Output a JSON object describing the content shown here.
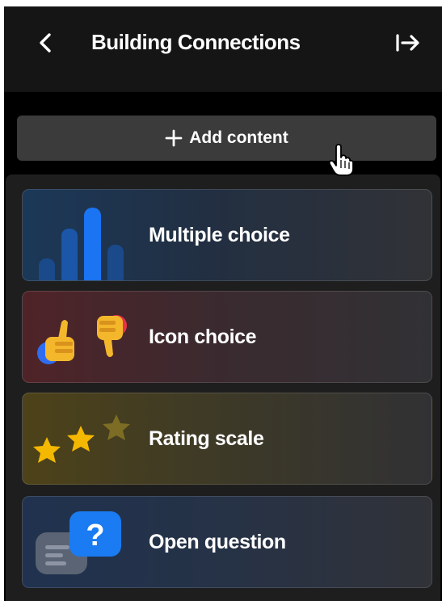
{
  "header": {
    "title": "Building Connections",
    "back_icon": "chevron-left-icon",
    "collapse_icon": "arrow-right-to-line-icon"
  },
  "add_content": {
    "label": "Add content",
    "icon": "plus-icon"
  },
  "menu": {
    "items": [
      {
        "label": "Multiple choice",
        "icon": "bar-chart-icon",
        "accent": "#1e6ef0"
      },
      {
        "label": "Icon choice",
        "icon": "thumbs-icon",
        "accent": "#f2b72b"
      },
      {
        "label": "Rating scale",
        "icon": "stars-icon",
        "accent": "#f5b800"
      },
      {
        "label": "Open question",
        "icon": "question-bubble-icon",
        "accent": "#1a7bf2"
      }
    ]
  },
  "colors": {
    "header_bg": "#151515",
    "panel_bg": "#000000",
    "button_bg": "#3b3b3b",
    "text": "#ffffff"
  }
}
